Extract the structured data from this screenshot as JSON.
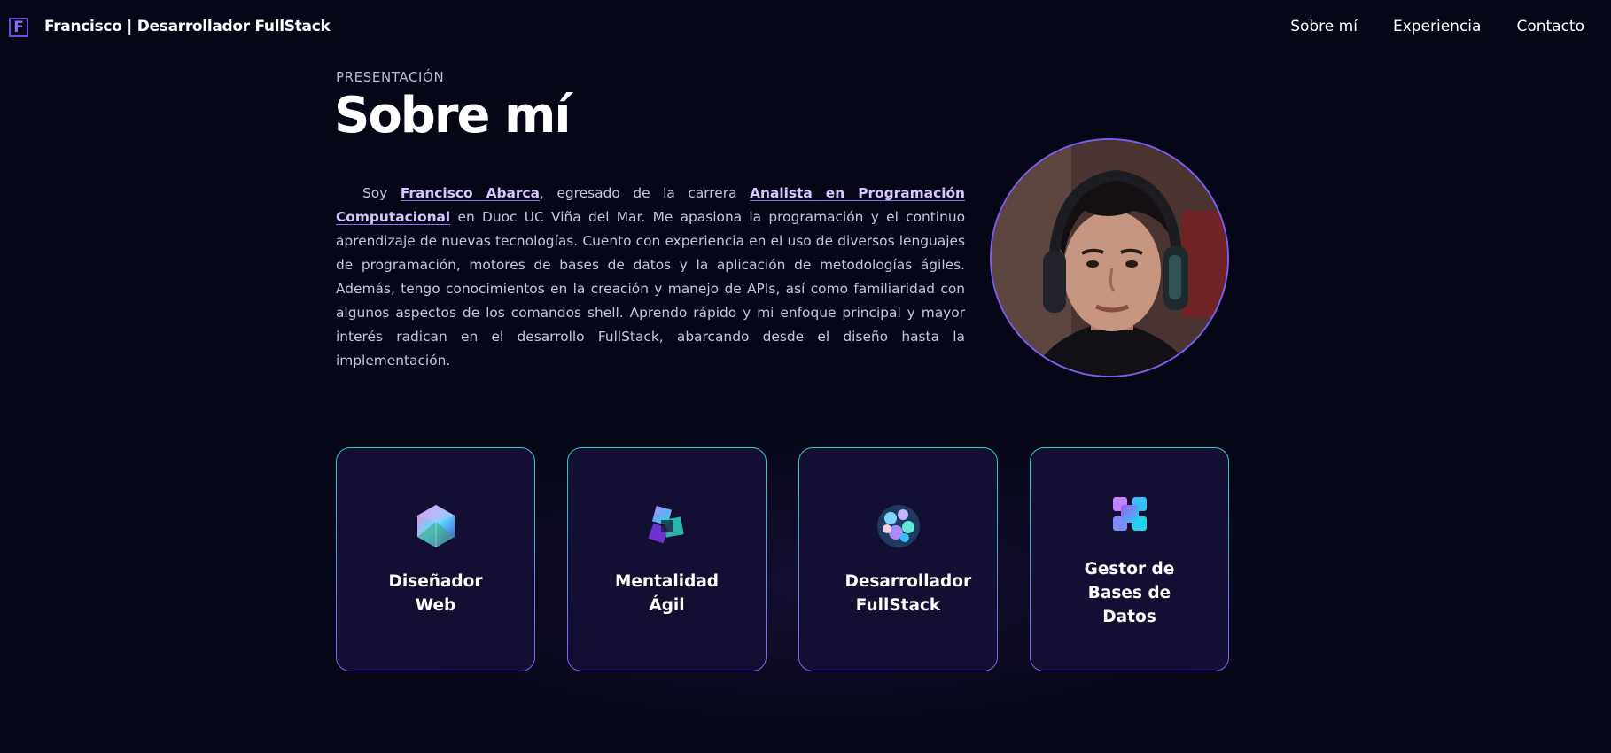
{
  "header": {
    "logo_letter": "F",
    "site_title": "Francisco | Desarrollador FullStack",
    "nav": [
      "Sobre mí",
      "Experiencia",
      "Contacto"
    ]
  },
  "about": {
    "eyebrow": "PRESENTACIÓN",
    "title": "Sobre mí",
    "bio": {
      "intro": "Soy ",
      "name": "Francisco Abarca",
      "mid": ", egresado de la carrera ",
      "degree": "Analista en Programación Computacional",
      "rest": "  en Duoc UC Viña del Mar. Me apasiona la programación y el continuo aprendizaje de nuevas tecnologías. Cuento con experiencia en el uso de diversos lenguajes de programación, motores de bases de datos y la aplicación de metodologías ágiles. Además, tengo conocimientos en la creación y manejo de APIs, así como familiaridad con algunos aspectos de los comandos shell. Aprendo rápido y mi enfoque principal y mayor interés radican en el desarrollo FullStack, abarcando desde el diseño hasta la implementación."
    }
  },
  "cards": [
    {
      "icon": "icosahedron-icon",
      "title": "Diseñador Web"
    },
    {
      "icon": "cube-knot-icon",
      "title": "Mentalidad Ágil"
    },
    {
      "icon": "sphere-cluster-icon",
      "title": "Desarrollador FullStack"
    },
    {
      "icon": "cross-blocks-icon",
      "title": "Gestor de Bases de Datos"
    }
  ],
  "colors": {
    "background": "#050716",
    "accent": "#8a6bff",
    "card_bg": "#130f32",
    "card_border_top": "#2fd0b8",
    "card_border_bottom": "#8a5cf6"
  }
}
